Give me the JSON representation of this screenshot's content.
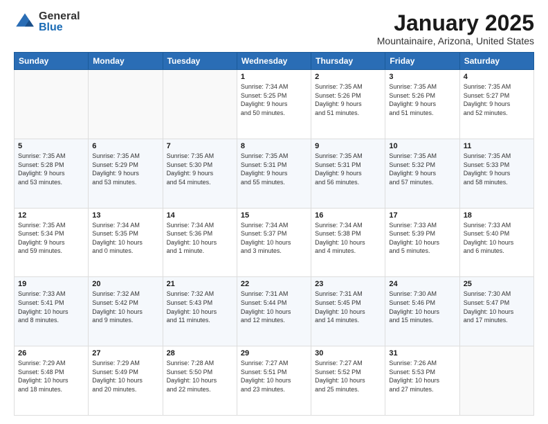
{
  "logo": {
    "general": "General",
    "blue": "Blue"
  },
  "header": {
    "title": "January 2025",
    "subtitle": "Mountainaire, Arizona, United States"
  },
  "weekdays": [
    "Sunday",
    "Monday",
    "Tuesday",
    "Wednesday",
    "Thursday",
    "Friday",
    "Saturday"
  ],
  "weeks": [
    [
      {
        "day": "",
        "detail": ""
      },
      {
        "day": "",
        "detail": ""
      },
      {
        "day": "",
        "detail": ""
      },
      {
        "day": "1",
        "detail": "Sunrise: 7:34 AM\nSunset: 5:25 PM\nDaylight: 9 hours\nand 50 minutes."
      },
      {
        "day": "2",
        "detail": "Sunrise: 7:35 AM\nSunset: 5:26 PM\nDaylight: 9 hours\nand 51 minutes."
      },
      {
        "day": "3",
        "detail": "Sunrise: 7:35 AM\nSunset: 5:26 PM\nDaylight: 9 hours\nand 51 minutes."
      },
      {
        "day": "4",
        "detail": "Sunrise: 7:35 AM\nSunset: 5:27 PM\nDaylight: 9 hours\nand 52 minutes."
      }
    ],
    [
      {
        "day": "5",
        "detail": "Sunrise: 7:35 AM\nSunset: 5:28 PM\nDaylight: 9 hours\nand 53 minutes."
      },
      {
        "day": "6",
        "detail": "Sunrise: 7:35 AM\nSunset: 5:29 PM\nDaylight: 9 hours\nand 53 minutes."
      },
      {
        "day": "7",
        "detail": "Sunrise: 7:35 AM\nSunset: 5:30 PM\nDaylight: 9 hours\nand 54 minutes."
      },
      {
        "day": "8",
        "detail": "Sunrise: 7:35 AM\nSunset: 5:31 PM\nDaylight: 9 hours\nand 55 minutes."
      },
      {
        "day": "9",
        "detail": "Sunrise: 7:35 AM\nSunset: 5:31 PM\nDaylight: 9 hours\nand 56 minutes."
      },
      {
        "day": "10",
        "detail": "Sunrise: 7:35 AM\nSunset: 5:32 PM\nDaylight: 9 hours\nand 57 minutes."
      },
      {
        "day": "11",
        "detail": "Sunrise: 7:35 AM\nSunset: 5:33 PM\nDaylight: 9 hours\nand 58 minutes."
      }
    ],
    [
      {
        "day": "12",
        "detail": "Sunrise: 7:35 AM\nSunset: 5:34 PM\nDaylight: 9 hours\nand 59 minutes."
      },
      {
        "day": "13",
        "detail": "Sunrise: 7:34 AM\nSunset: 5:35 PM\nDaylight: 10 hours\nand 0 minutes."
      },
      {
        "day": "14",
        "detail": "Sunrise: 7:34 AM\nSunset: 5:36 PM\nDaylight: 10 hours\nand 1 minute."
      },
      {
        "day": "15",
        "detail": "Sunrise: 7:34 AM\nSunset: 5:37 PM\nDaylight: 10 hours\nand 3 minutes."
      },
      {
        "day": "16",
        "detail": "Sunrise: 7:34 AM\nSunset: 5:38 PM\nDaylight: 10 hours\nand 4 minutes."
      },
      {
        "day": "17",
        "detail": "Sunrise: 7:33 AM\nSunset: 5:39 PM\nDaylight: 10 hours\nand 5 minutes."
      },
      {
        "day": "18",
        "detail": "Sunrise: 7:33 AM\nSunset: 5:40 PM\nDaylight: 10 hours\nand 6 minutes."
      }
    ],
    [
      {
        "day": "19",
        "detail": "Sunrise: 7:33 AM\nSunset: 5:41 PM\nDaylight: 10 hours\nand 8 minutes."
      },
      {
        "day": "20",
        "detail": "Sunrise: 7:32 AM\nSunset: 5:42 PM\nDaylight: 10 hours\nand 9 minutes."
      },
      {
        "day": "21",
        "detail": "Sunrise: 7:32 AM\nSunset: 5:43 PM\nDaylight: 10 hours\nand 11 minutes."
      },
      {
        "day": "22",
        "detail": "Sunrise: 7:31 AM\nSunset: 5:44 PM\nDaylight: 10 hours\nand 12 minutes."
      },
      {
        "day": "23",
        "detail": "Sunrise: 7:31 AM\nSunset: 5:45 PM\nDaylight: 10 hours\nand 14 minutes."
      },
      {
        "day": "24",
        "detail": "Sunrise: 7:30 AM\nSunset: 5:46 PM\nDaylight: 10 hours\nand 15 minutes."
      },
      {
        "day": "25",
        "detail": "Sunrise: 7:30 AM\nSunset: 5:47 PM\nDaylight: 10 hours\nand 17 minutes."
      }
    ],
    [
      {
        "day": "26",
        "detail": "Sunrise: 7:29 AM\nSunset: 5:48 PM\nDaylight: 10 hours\nand 18 minutes."
      },
      {
        "day": "27",
        "detail": "Sunrise: 7:29 AM\nSunset: 5:49 PM\nDaylight: 10 hours\nand 20 minutes."
      },
      {
        "day": "28",
        "detail": "Sunrise: 7:28 AM\nSunset: 5:50 PM\nDaylight: 10 hours\nand 22 minutes."
      },
      {
        "day": "29",
        "detail": "Sunrise: 7:27 AM\nSunset: 5:51 PM\nDaylight: 10 hours\nand 23 minutes."
      },
      {
        "day": "30",
        "detail": "Sunrise: 7:27 AM\nSunset: 5:52 PM\nDaylight: 10 hours\nand 25 minutes."
      },
      {
        "day": "31",
        "detail": "Sunrise: 7:26 AM\nSunset: 5:53 PM\nDaylight: 10 hours\nand 27 minutes."
      },
      {
        "day": "",
        "detail": ""
      }
    ]
  ]
}
